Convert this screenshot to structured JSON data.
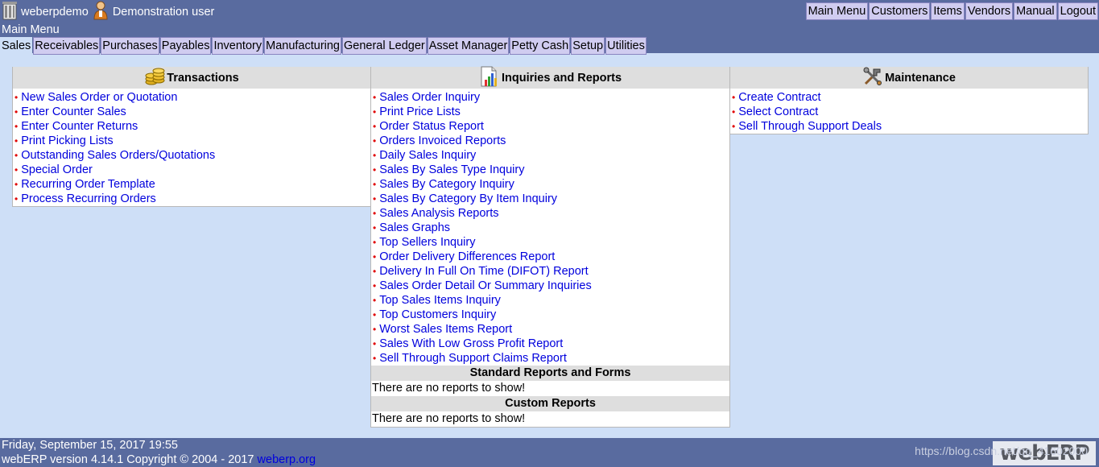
{
  "header": {
    "company": "weberpdemo",
    "user": "Demonstration user",
    "menu_title": "Main Menu",
    "quicklinks": [
      "Main Menu",
      "Customers",
      "Items",
      "Vendors",
      "Manual",
      "Logout"
    ],
    "tabs": [
      "Sales",
      "Receivables",
      "Purchases",
      "Payables",
      "Inventory",
      "Manufacturing",
      "General Ledger",
      "Asset Manager",
      "Petty Cash",
      "Setup",
      "Utilities"
    ],
    "active_tab": "Sales"
  },
  "transactions": {
    "title": "Transactions",
    "icon": "coins-icon",
    "items": [
      "New Sales Order or Quotation",
      "Enter Counter Sales",
      "Enter Counter Returns",
      "Print Picking Lists",
      "Outstanding Sales Orders/Quotations",
      "Special Order",
      "Recurring Order Template",
      "Process Recurring Orders"
    ]
  },
  "inquiries": {
    "title": "Inquiries and Reports",
    "icon": "report-chart-icon",
    "items": [
      "Sales Order Inquiry",
      "Print Price Lists",
      "Order Status Report",
      "Orders Invoiced Reports",
      "Daily Sales Inquiry",
      "Sales By Sales Type Inquiry",
      "Sales By Category Inquiry",
      "Sales By Category By Item Inquiry",
      "Sales Analysis Reports",
      "Sales Graphs",
      "Top Sellers Inquiry",
      "Order Delivery Differences Report",
      "Delivery In Full On Time (DIFOT) Report",
      "Sales Order Detail Or Summary Inquiries",
      "Top Sales Items Inquiry",
      "Top Customers Inquiry",
      "Worst Sales Items Report",
      "Sales With Low Gross Profit Report",
      "Sell Through Support Claims Report"
    ],
    "standard_title": "Standard Reports and Forms",
    "standard_empty": "There are no reports to show!",
    "custom_title": "Custom Reports",
    "custom_empty": "There are no reports to show!"
  },
  "maintenance": {
    "title": "Maintenance",
    "icon": "tools-icon",
    "items": [
      "Create Contract",
      "Select Contract",
      "Sell Through Support Deals"
    ]
  },
  "footer": {
    "datetime": "Friday, September 15, 2017 19:55",
    "version": "webERP version 4.14.1 Copyright © 2004 - 2017",
    "link": "weberp.org",
    "watermark": "https://blog.csdn.net/qq_41602000",
    "logo": "webERP"
  },
  "colors": {
    "header_bg": "#596b9f",
    "page_bg": "#cedff7",
    "link": "#0000dd",
    "bullet": "#e00000"
  }
}
